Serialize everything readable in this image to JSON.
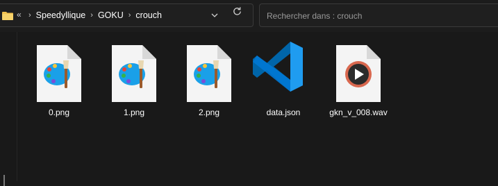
{
  "breadcrumb": {
    "overflow": "«",
    "items": [
      "Speedyllique",
      "GOKU",
      "crouch"
    ],
    "separator": "›"
  },
  "search": {
    "placeholder": "Rechercher dans : crouch"
  },
  "files": [
    {
      "name": "0.png",
      "icon": "paint-image-icon"
    },
    {
      "name": "1.png",
      "icon": "paint-image-icon"
    },
    {
      "name": "2.png",
      "icon": "paint-image-icon"
    },
    {
      "name": "data.json",
      "icon": "vscode-icon"
    },
    {
      "name": "gkn_v_008.wav",
      "icon": "media-player-icon"
    }
  ],
  "colors": {
    "folder": "#f3c24f",
    "vscode_blue": "#1f9cf0",
    "vscode_dark": "#0065a9",
    "media_ring": "#d9684f"
  }
}
